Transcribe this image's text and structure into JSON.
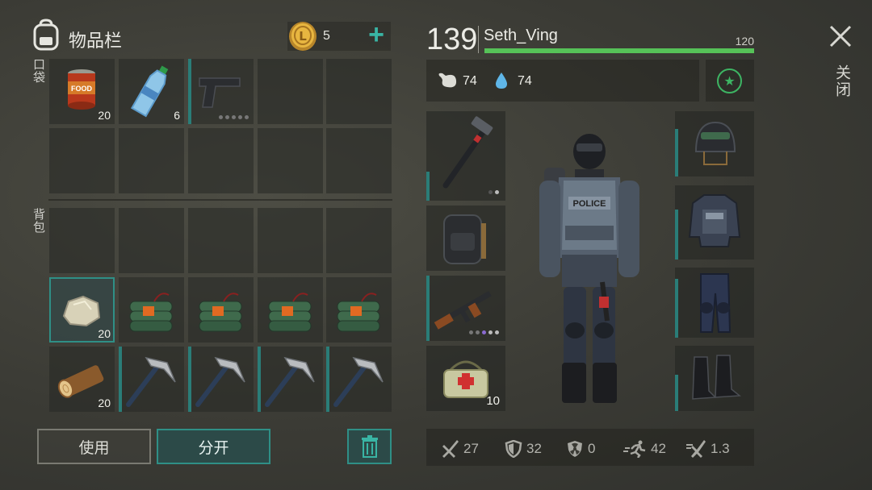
{
  "inventory": {
    "title": "物品栏",
    "coins": "5",
    "add_label": "+",
    "pocket_label": "口袋",
    "backpack_label": "背包",
    "slots": [
      {
        "item": "canned-food",
        "qty": "20"
      },
      {
        "item": "water-bottle",
        "qty": "6"
      },
      {
        "item": "pistol",
        "qty": ""
      },
      {
        "item": "",
        "qty": ""
      },
      {
        "item": "",
        "qty": ""
      },
      {
        "item": "",
        "qty": ""
      },
      {
        "item": "",
        "qty": ""
      },
      {
        "item": "",
        "qty": ""
      },
      {
        "item": "",
        "qty": ""
      },
      {
        "item": "",
        "qty": ""
      },
      {
        "item": "",
        "qty": ""
      },
      {
        "item": "",
        "qty": ""
      },
      {
        "item": "",
        "qty": ""
      },
      {
        "item": "",
        "qty": ""
      },
      {
        "item": "",
        "qty": ""
      },
      {
        "item": "stone",
        "qty": "20"
      },
      {
        "item": "dynamite",
        "qty": ""
      },
      {
        "item": "dynamite",
        "qty": ""
      },
      {
        "item": "dynamite",
        "qty": ""
      },
      {
        "item": "dynamite",
        "qty": ""
      },
      {
        "item": "wood-log",
        "qty": "20"
      },
      {
        "item": "pickaxe",
        "qty": ""
      },
      {
        "item": "pickaxe",
        "qty": ""
      },
      {
        "item": "pickaxe",
        "qty": ""
      },
      {
        "item": "pickaxe",
        "qty": ""
      }
    ]
  },
  "actions": {
    "use_label": "使用",
    "split_label": "分开"
  },
  "player": {
    "level": "139",
    "name": "Seth_Ving",
    "hp_max": "120",
    "hp_fraction": 1.0,
    "food": "74",
    "water": "74"
  },
  "equipment": {
    "weapon_slots": [
      {
        "item": "sledgehammer",
        "qty": ""
      },
      {
        "item": "backpack",
        "qty": ""
      },
      {
        "item": "assault-rifle",
        "qty": ""
      },
      {
        "item": "medkit",
        "qty": "10"
      }
    ],
    "armor_slots": [
      {
        "item": "helmet"
      },
      {
        "item": "body-armor"
      },
      {
        "item": "armored-pants"
      },
      {
        "item": "boots"
      }
    ],
    "vest_text": "POLICE"
  },
  "stats": {
    "attack": "27",
    "defense": "32",
    "radiation": "0",
    "speed": "42",
    "attack_speed": "1.3"
  },
  "close_label": "关闭",
  "colors": {
    "accent": "#2f8f86",
    "health": "#56c258",
    "star": "#3db463"
  }
}
